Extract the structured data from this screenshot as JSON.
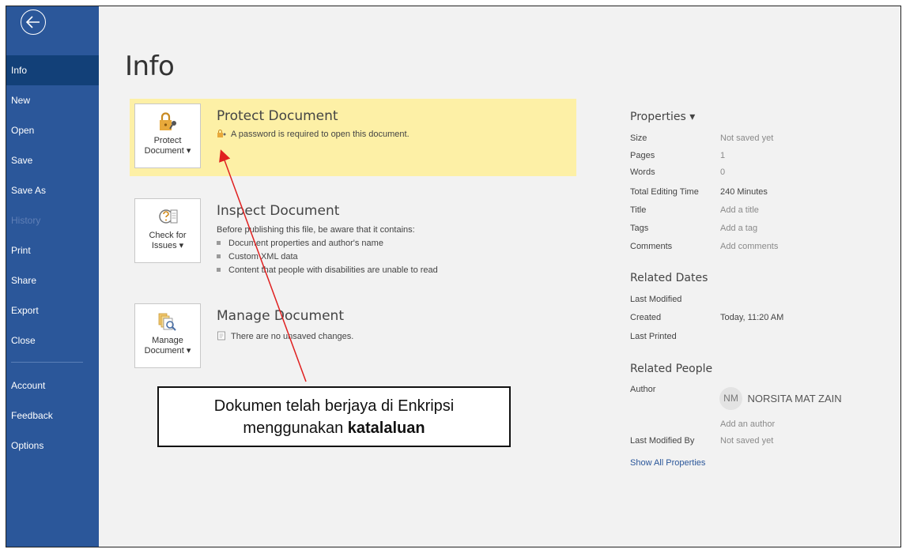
{
  "sidebar": {
    "back_icon": "back-arrow-icon",
    "items": [
      {
        "label": "Info",
        "state": "active"
      },
      {
        "label": "New",
        "state": "normal"
      },
      {
        "label": "Open",
        "state": "normal"
      },
      {
        "label": "Save",
        "state": "normal"
      },
      {
        "label": "Save As",
        "state": "normal"
      },
      {
        "label": "History",
        "state": "disabled"
      },
      {
        "label": "Print",
        "state": "normal"
      },
      {
        "label": "Share",
        "state": "normal"
      },
      {
        "label": "Export",
        "state": "normal"
      },
      {
        "label": "Close",
        "state": "normal"
      }
    ],
    "bottom_items": [
      {
        "label": "Account"
      },
      {
        "label": "Feedback"
      },
      {
        "label": "Options"
      }
    ]
  },
  "main": {
    "title": "Info",
    "protect": {
      "button_line1": "Protect",
      "button_line2": "Document ▾",
      "icon": "lock-key-icon",
      "title": "Protect Document",
      "status": "A password is required to open this document.",
      "highlight_color": "#fdf0a6"
    },
    "inspect": {
      "button_line1": "Check for",
      "button_line2": "Issues ▾",
      "icon": "inspect-document-icon",
      "title": "Inspect Document",
      "description": "Before publishing this file, be aware that it contains:",
      "bullets": [
        "Document properties and author's name",
        "Custom XML data",
        "Content that people with disabilities are unable to read"
      ]
    },
    "manage": {
      "button_line1": "Manage",
      "button_line2": "Document ▾",
      "icon": "manage-document-icon",
      "title": "Manage Document",
      "status": "There are no unsaved changes."
    }
  },
  "properties": {
    "header": "Properties ▾",
    "rows": [
      {
        "key": "Size",
        "value": "Not saved yet"
      },
      {
        "key": "Pages",
        "value": "1"
      },
      {
        "key": "Words",
        "value": "0"
      },
      {
        "key": "Total Editing Time",
        "value": "240 Minutes"
      },
      {
        "key": "Title",
        "value": "Add a title"
      },
      {
        "key": "Tags",
        "value": "Add a tag"
      },
      {
        "key": "Comments",
        "value": "Add comments"
      }
    ],
    "related_dates": {
      "header": "Related Dates",
      "last_modified": "Last Modified",
      "created_key": "Created",
      "created_value": "Today, 11:20 AM",
      "last_printed": "Last Printed"
    },
    "related_people": {
      "header": "Related People",
      "author_key": "Author",
      "author_initials": "NM",
      "author_name": "NORSITA MAT ZAIN",
      "add_author": "Add an author",
      "last_modified_by_key": "Last Modified By",
      "last_modified_by_value": "Not saved yet"
    },
    "show_all": "Show All Properties"
  },
  "annotation": {
    "line1": "Dokumen telah berjaya di Enkripsi",
    "line2_prefix": "menggunakan ",
    "line2_bold": "katalaluan",
    "arrow_color": "#e02020"
  },
  "colors": {
    "sidebar": "#2b579a",
    "sidebar_active": "#124078",
    "background": "#f2f2f2",
    "link": "#2b579a"
  }
}
